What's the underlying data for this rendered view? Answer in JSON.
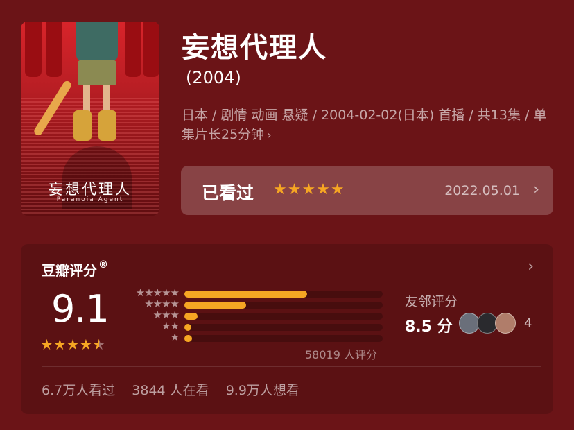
{
  "poster": {
    "title": "妄想代理人",
    "subtitle": "Paranoia Agent"
  },
  "title": "妄想代理人",
  "year": "(2004)",
  "meta": "日本 / 剧情 动画 悬疑 / 2004-02-02(日本) 首播 / 共13集 / 单集片长25分钟",
  "meta_chevron": "›",
  "watched": {
    "label": "已看过",
    "stars": "★★★★★",
    "date": "2022.05.01",
    "chevron": "›"
  },
  "rating": {
    "title": "豆瓣评分",
    "registered": "®",
    "chevron": "›",
    "score": "9.1",
    "stars_full": "★★★★",
    "stars_half": "★",
    "distribution": [
      {
        "stars": "★★★★★",
        "fraction": 0.62
      },
      {
        "stars": "★★★★",
        "fraction": 0.31
      },
      {
        "stars": "★★★",
        "fraction": 0.065
      },
      {
        "stars": "★★",
        "fraction": 0.035
      },
      {
        "stars": "★",
        "fraction": 0.04
      }
    ],
    "count": "58019 人评分",
    "friend_label": "友邻评分",
    "friend_score": "8.5 分",
    "friend_count": "4",
    "avatar_colors": [
      "#6a6f7a",
      "#2a2a2e",
      "#b07d6a"
    ]
  },
  "footer": {
    "watched": "6.7万人看过",
    "watching": "3844 人在看",
    "want": "9.9万人想看"
  },
  "colors": {
    "background": "#6b1417",
    "accent": "#f6a623"
  }
}
